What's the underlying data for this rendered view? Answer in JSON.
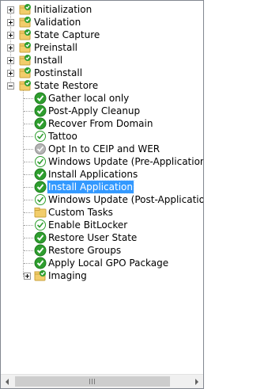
{
  "tree": {
    "items": [
      {
        "label": "Initialization",
        "icon": "folder-check-icon",
        "expander": "collapsed"
      },
      {
        "label": "Validation",
        "icon": "folder-check-icon",
        "expander": "collapsed"
      },
      {
        "label": "State Capture",
        "icon": "folder-check-icon",
        "expander": "collapsed"
      },
      {
        "label": "Preinstall",
        "icon": "folder-check-icon",
        "expander": "collapsed"
      },
      {
        "label": "Install",
        "icon": "folder-check-icon",
        "expander": "collapsed"
      },
      {
        "label": "Postinstall",
        "icon": "folder-check-icon",
        "expander": "collapsed"
      },
      {
        "label": "State Restore",
        "icon": "folder-check-icon",
        "expander": "expanded"
      },
      {
        "label": "Gather local only",
        "icon": "green-check-icon"
      },
      {
        "label": "Post-Apply Cleanup",
        "icon": "green-check-icon"
      },
      {
        "label": "Recover From Domain",
        "icon": "green-check-icon"
      },
      {
        "label": "Tattoo",
        "icon": "outline-check-icon"
      },
      {
        "label": "Opt In to CEIP and WER",
        "icon": "disabled-check-icon"
      },
      {
        "label": "Windows Update (Pre-Application Installation)",
        "icon": "outline-check-icon"
      },
      {
        "label": "Install Applications",
        "icon": "green-check-icon"
      },
      {
        "label": "Install Application",
        "icon": "green-check-icon",
        "selected": true
      },
      {
        "label": "Windows Update (Post-Application Installation)",
        "icon": "outline-check-icon"
      },
      {
        "label": "Custom Tasks",
        "icon": "folder-icon"
      },
      {
        "label": "Enable BitLocker",
        "icon": "outline-check-icon"
      },
      {
        "label": "Restore User State",
        "icon": "green-check-icon"
      },
      {
        "label": "Restore Groups",
        "icon": "green-check-icon"
      },
      {
        "label": "Apply Local GPO Package",
        "icon": "green-check-icon"
      },
      {
        "label": "Imaging",
        "icon": "folder-check-icon",
        "expander": "collapsed"
      }
    ]
  },
  "scrollbar": {
    "left_icon": "scroll-left-icon",
    "right_icon": "scroll-right-icon",
    "thumb_icon": "grip-icon"
  },
  "colors": {
    "selection": "#3399ff",
    "check_green": "#2e9e2e",
    "folder": "#f2cd6b"
  }
}
